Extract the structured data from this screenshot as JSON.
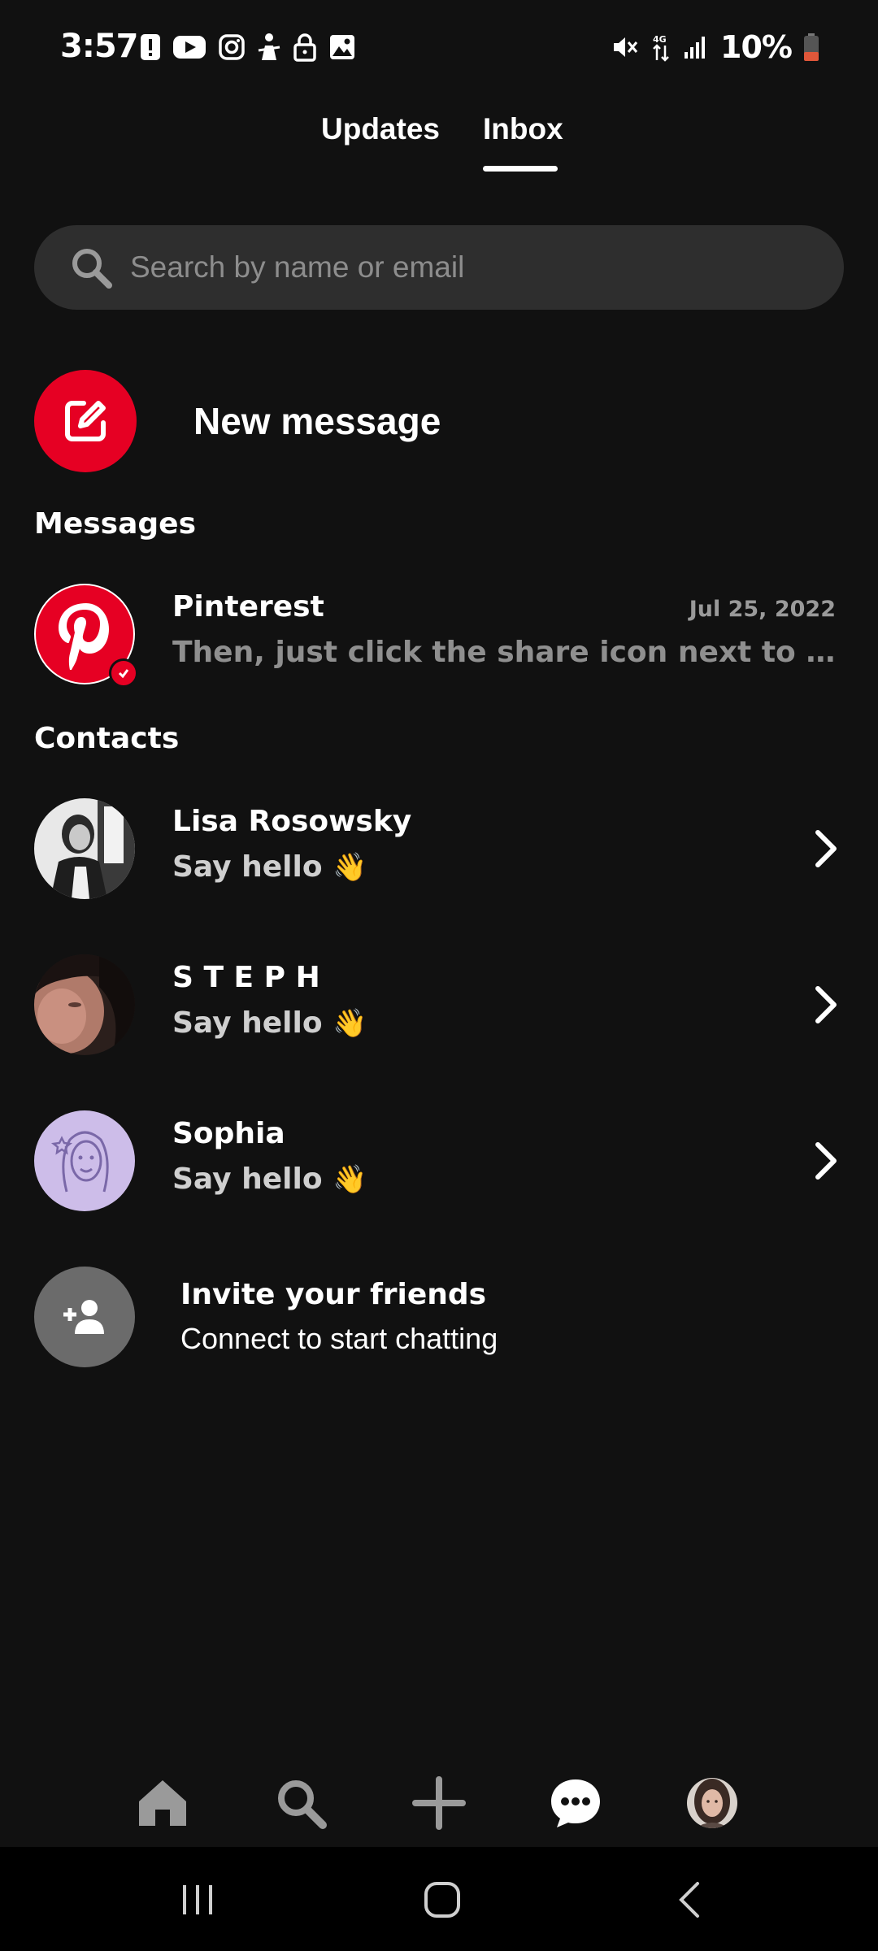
{
  "status_bar": {
    "time": "3:57",
    "battery": "10%",
    "left_icons": [
      "alert-icon",
      "youtube-icon",
      "instagram-icon",
      "app-icon",
      "lock-icon",
      "image-icon"
    ],
    "right_icons": [
      "mute-icon",
      "data-icon",
      "signal-icon",
      "battery-icon"
    ],
    "battery_low_color": "#e0573a"
  },
  "tabs": [
    {
      "label": "Updates",
      "active": false
    },
    {
      "label": "Inbox",
      "active": true
    }
  ],
  "search": {
    "placeholder": "Search by name or email",
    "value": ""
  },
  "new_message": {
    "label": "New message",
    "accent": "#e60023"
  },
  "messages": {
    "header": "Messages",
    "items": [
      {
        "name": "Pinterest",
        "date": "Jul 25, 2022",
        "preview": "Then, just click the share icon next to any Pin to send it to friends",
        "verified": true
      }
    ]
  },
  "contacts": {
    "header": "Contacts",
    "items": [
      {
        "name": "Lisa Rosowsky",
        "subtitle": "Say hello",
        "emoji": "👋"
      },
      {
        "name": "S T E P H",
        "subtitle": "Say hello",
        "emoji": "👋"
      },
      {
        "name": "Sophia",
        "subtitle": "Say hello",
        "emoji": "👋"
      }
    ]
  },
  "invite": {
    "title": "Invite your friends",
    "subtitle": "Connect to start chatting"
  },
  "bottom_nav": [
    {
      "icon": "home-icon",
      "active": false
    },
    {
      "icon": "search-icon",
      "active": false
    },
    {
      "icon": "plus-icon",
      "active": false
    },
    {
      "icon": "chat-icon",
      "active": true
    },
    {
      "icon": "profile-avatar",
      "active": false
    }
  ],
  "system_nav": [
    "recent-apps-icon",
    "home-circle-icon",
    "back-icon"
  ],
  "colors": {
    "background": "#111111",
    "brand_red": "#e60023",
    "search_bg": "#2e2e2e",
    "muted_text": "#8f8f8f"
  }
}
